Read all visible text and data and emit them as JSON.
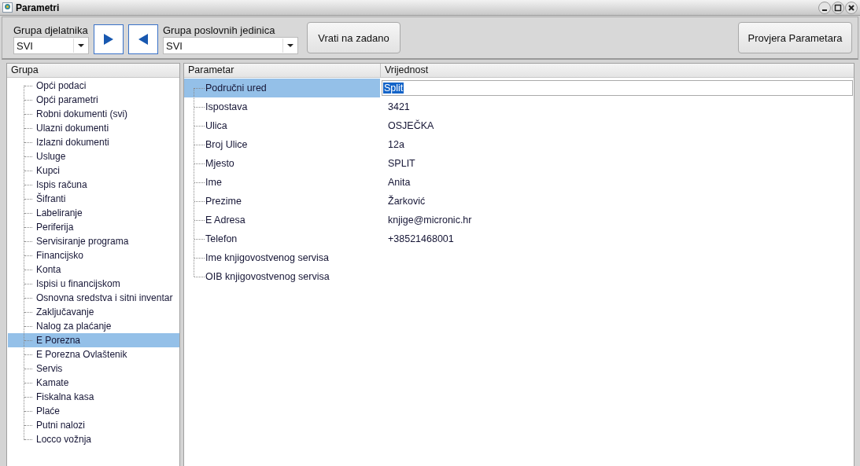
{
  "window": {
    "title": "Parametri"
  },
  "toolbar": {
    "employee_group": {
      "label": "Grupa djelatnika",
      "value": "SVI"
    },
    "unit_group": {
      "label": "Grupa poslovnih jedinica",
      "value": "SVI"
    },
    "reset_button": "Vrati na zadano",
    "check_button": "Provjera Parametara"
  },
  "groups": {
    "header": "Grupa",
    "items": [
      {
        "label": "Opći podaci",
        "selected": false
      },
      {
        "label": "Opći parametri",
        "selected": false
      },
      {
        "label": "Robni dokumenti (svi)",
        "selected": false
      },
      {
        "label": "Ulazni dokumenti",
        "selected": false
      },
      {
        "label": "Izlazni dokumenti",
        "selected": false
      },
      {
        "label": "Usluge",
        "selected": false
      },
      {
        "label": "Kupci",
        "selected": false
      },
      {
        "label": "Ispis računa",
        "selected": false
      },
      {
        "label": "Šifranti",
        "selected": false
      },
      {
        "label": "Labeliranje",
        "selected": false
      },
      {
        "label": "Periferija",
        "selected": false
      },
      {
        "label": "Servisiranje programa",
        "selected": false
      },
      {
        "label": "Financijsko",
        "selected": false
      },
      {
        "label": "Konta",
        "selected": false
      },
      {
        "label": "Ispisi u financijskom",
        "selected": false
      },
      {
        "label": "Osnovna sredstva i sitni inventar",
        "selected": false
      },
      {
        "label": "Zaključavanje",
        "selected": false
      },
      {
        "label": "Nalog za plaćanje",
        "selected": false
      },
      {
        "label": "E Porezna",
        "selected": true
      },
      {
        "label": "E Porezna Ovlaštenik",
        "selected": false
      },
      {
        "label": "Servis",
        "selected": false
      },
      {
        "label": "Kamate",
        "selected": false
      },
      {
        "label": "Fiskalna kasa",
        "selected": false
      },
      {
        "label": "Plaće",
        "selected": false
      },
      {
        "label": "Putni nalozi",
        "selected": false
      },
      {
        "label": "Locco vožnja",
        "selected": false
      }
    ]
  },
  "parameters": {
    "columns": [
      "Parametar",
      "Vrijednost"
    ],
    "rows": [
      {
        "name": "Područni ured",
        "value": "Split",
        "selected": true
      },
      {
        "name": "Ispostava",
        "value": "3421",
        "selected": false
      },
      {
        "name": "Ulica",
        "value": "OSJEČKA",
        "selected": false
      },
      {
        "name": "Broj Ulice",
        "value": "12a",
        "selected": false
      },
      {
        "name": "Mjesto",
        "value": "SPLIT",
        "selected": false
      },
      {
        "name": "Ime",
        "value": "Anita",
        "selected": false
      },
      {
        "name": "Prezime",
        "value": "Žarković",
        "selected": false
      },
      {
        "name": "E Adresa",
        "value": "knjige@micronic.hr",
        "selected": false
      },
      {
        "name": "Telefon",
        "value": "+38521468001",
        "selected": false
      },
      {
        "name": "Ime knjigovostvenog servisa",
        "selected": false
      },
      {
        "name": "OIB knjigovostvenog servisa",
        "selected": false
      }
    ]
  }
}
